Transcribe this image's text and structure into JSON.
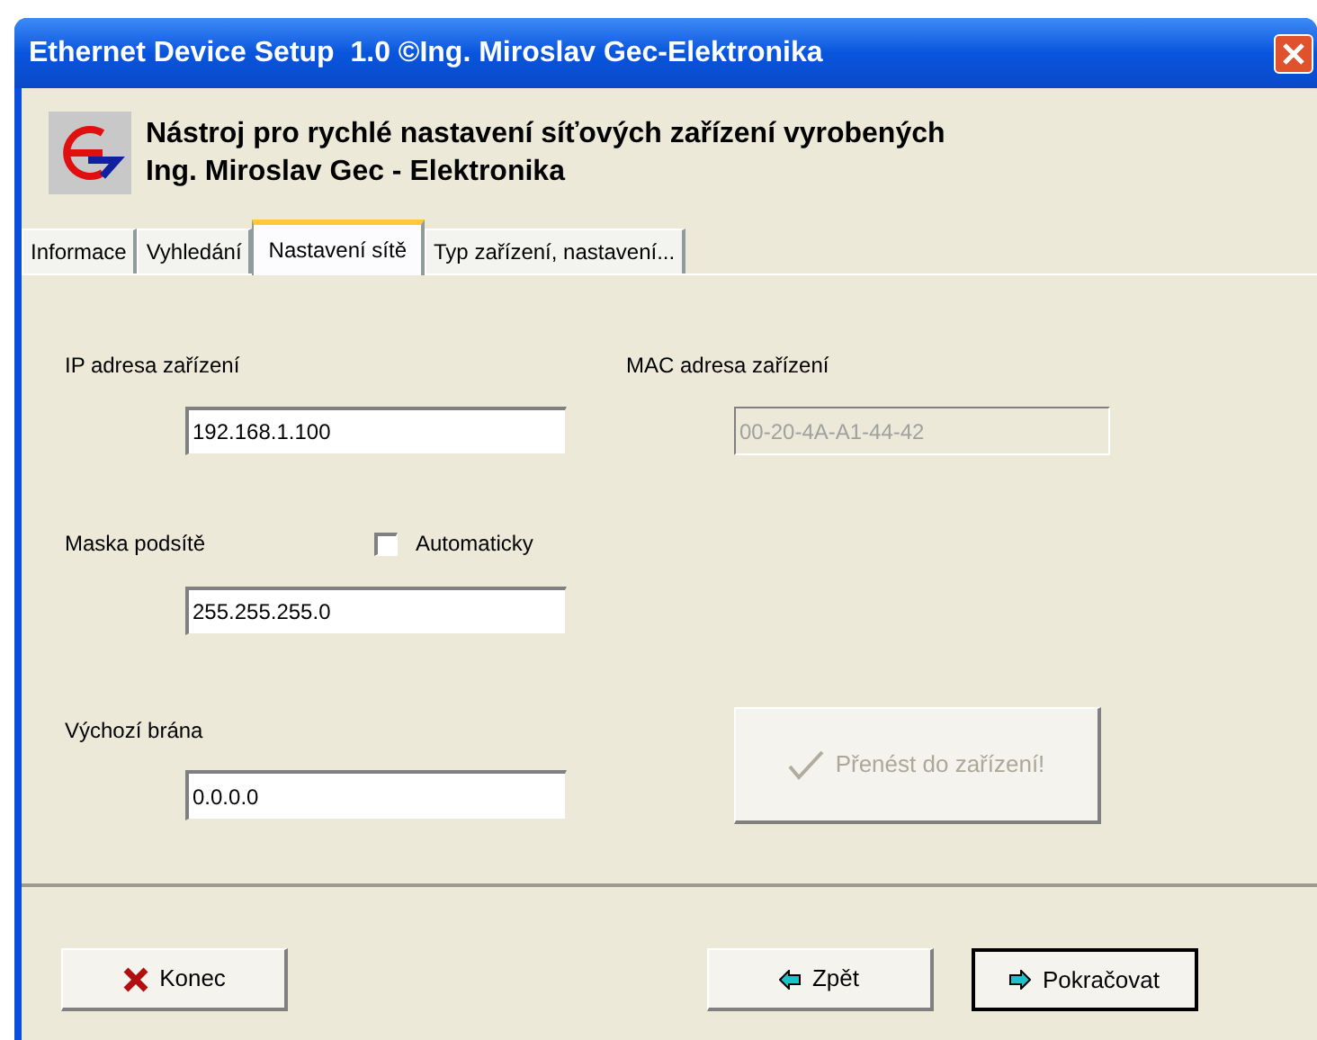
{
  "window": {
    "title": "Ethernet Device Setup  1.0 ©Ing. Miroslav Gec-Elektronika"
  },
  "header": {
    "lines": [
      "Nástroj pro rychlé nastavení síťových zařízení vyrobených",
      "Ing. Miroslav Gec - Elektronika"
    ]
  },
  "tabs": [
    {
      "label": "Informace",
      "selected": false
    },
    {
      "label": "Vyhledání",
      "selected": false
    },
    {
      "label": "Nastavení sítě",
      "selected": true
    },
    {
      "label": "Typ zařízení, nastavení...",
      "selected": false
    }
  ],
  "ip_address": {
    "label": "IP adresa zařízení",
    "value": "192.168.1.100",
    "disabled": false
  },
  "mac_address": {
    "label": "MAC adresa zařízení",
    "value": "00-20-4A-A1-44-42",
    "disabled": true
  },
  "subnet_mask": {
    "label": "Maska podsítě",
    "value": "255.255.255.0",
    "disabled": false,
    "auto_checkbox": {
      "label": "Automaticky",
      "checked": false
    }
  },
  "gateway": {
    "label": "Výchozí brána",
    "value": "0.0.0.0",
    "disabled": false
  },
  "transfer_button": {
    "label": "Přenést do zařízení!",
    "disabled": true
  },
  "buttons": [
    {
      "label": "Konec",
      "kind": "close",
      "default": false
    },
    {
      "label": "Zpět",
      "kind": "back",
      "default": false
    },
    {
      "label": "Pokračovat",
      "kind": "next",
      "default": true
    }
  ]
}
